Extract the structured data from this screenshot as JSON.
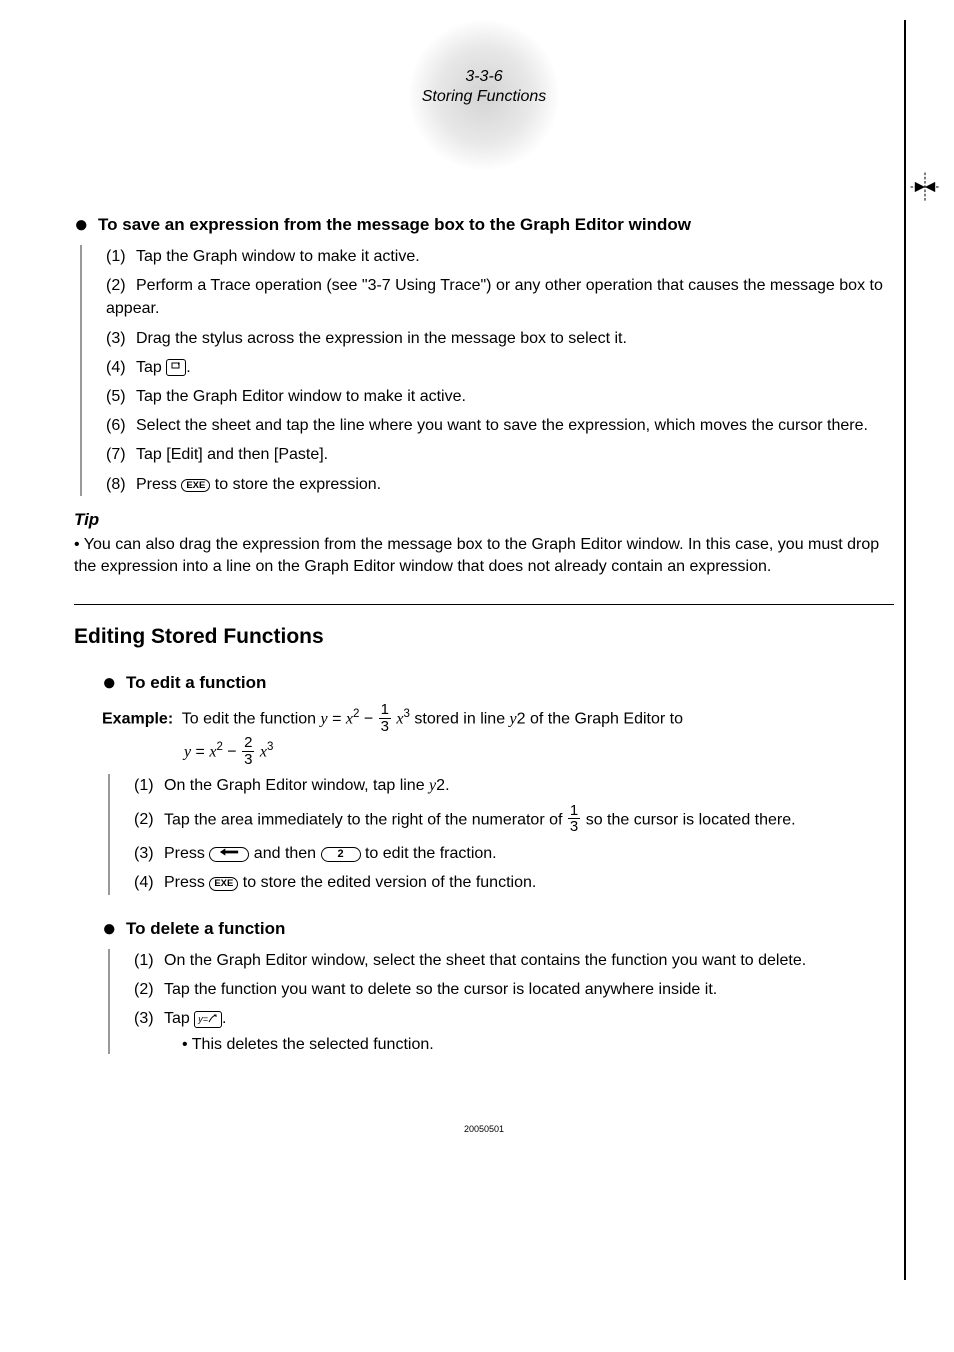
{
  "header": {
    "page_num": "3-3-6",
    "page_title": "Storing Functions"
  },
  "icons": {
    "copy": "⎘",
    "exe": "EXE",
    "backspace_arrow": "backspace",
    "key2": "2",
    "del_yx": "y=?⤺"
  },
  "sec1": {
    "heading": "To save an expression from the message box to the Graph Editor window",
    "s1": "Tap the Graph window to make it active.",
    "s2": "Perform a Trace operation (see \"3-7 Using Trace\") or any other operation that causes the message box to appear.",
    "s3": "Drag the stylus across the expression in the message box to select it.",
    "s4_pre": "Tap ",
    "s4_post": ".",
    "s5": "Tap the Graph Editor window to make it active.",
    "s6": "Select the sheet and tap the line where you want to save the expression, which moves the cursor there.",
    "s7": "Tap [Edit] and then [Paste].",
    "s8_pre": "Press ",
    "s8_post": " to store the expression."
  },
  "tip": {
    "head": "Tip",
    "body": "You can also drag the expression from the message box to the Graph Editor window. In this case, you must drop the expression into a line on the Graph Editor window that does not already contain an expression."
  },
  "sec2": {
    "title": "Editing Stored Functions",
    "edit": {
      "heading": "To edit a function",
      "example_label": "Example:",
      "example_pre": "To edit the function ",
      "example_mid": " stored in line ",
      "example_line": "y2",
      "example_post": " of the Graph Editor to",
      "frac1_n": "1",
      "frac1_d": "3",
      "frac2_n": "2",
      "frac2_d": "3",
      "s1_pre": "On the Graph Editor window, tap line ",
      "s1_line": "y2",
      "s1_post": ".",
      "s2_pre": "Tap the area immediately to the right of the numerator of ",
      "s2_post": " so the cursor is located there.",
      "s3_pre": "Press ",
      "s3_mid": " and then ",
      "s3_post": " to edit the fraction.",
      "s4_pre": "Press ",
      "s4_post": " to store the edited version of the function."
    },
    "del": {
      "heading": "To delete a function",
      "s1": "On the Graph Editor window, select the sheet that contains the function you want to delete.",
      "s2": "Tap the function you want to delete so the cursor is located anywhere inside it.",
      "s3_pre": "Tap ",
      "s3_post": ".",
      "sub": "This deletes the selected function."
    }
  },
  "footer": "20050501"
}
